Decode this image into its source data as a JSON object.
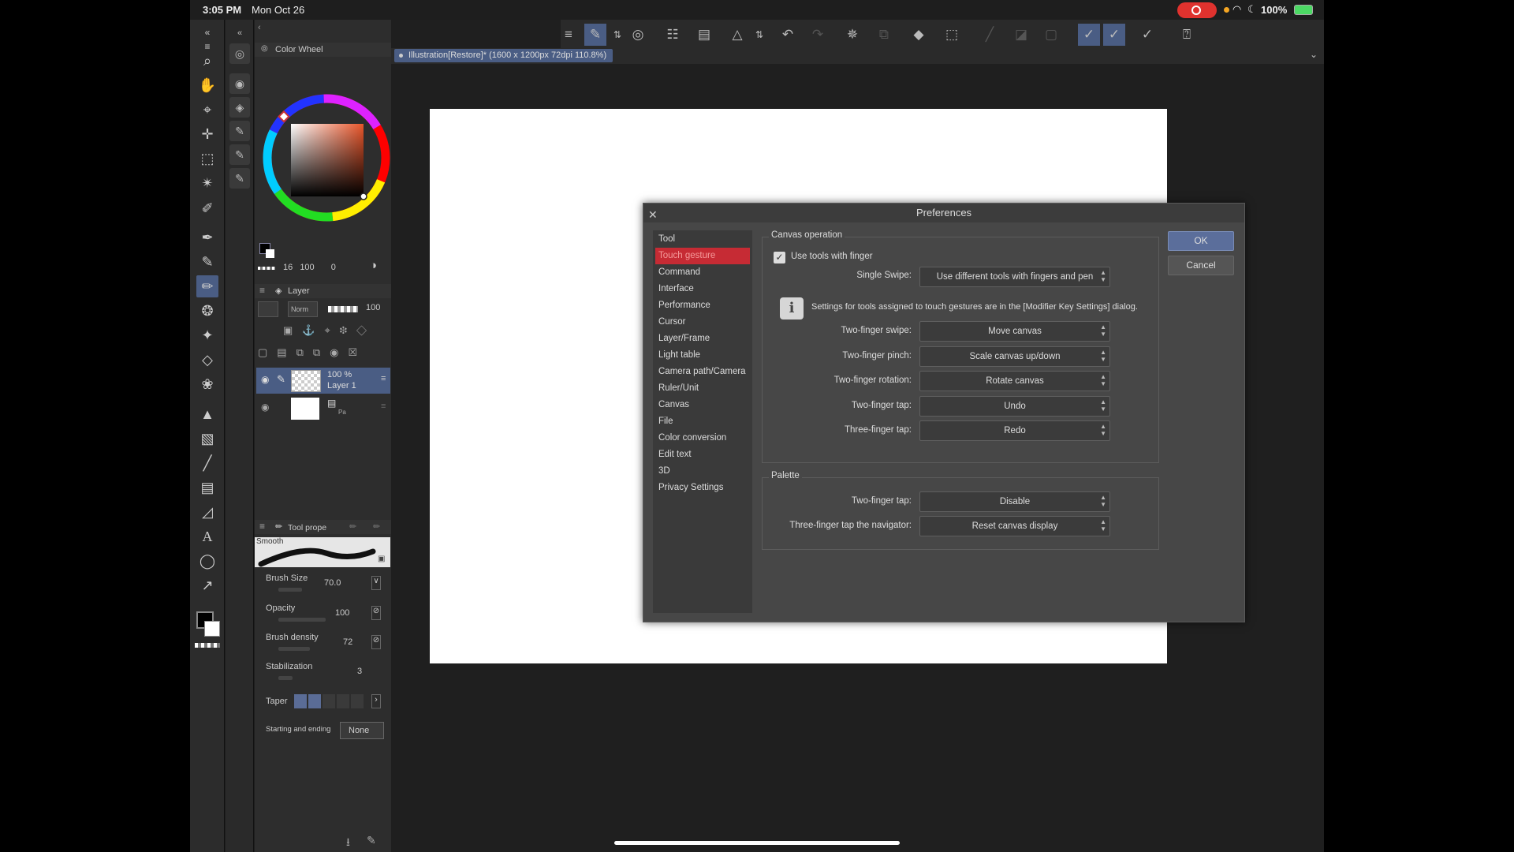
{
  "status_bar": {
    "time": "3:05 PM",
    "date": "Mon Oct 26",
    "battery": "100%"
  },
  "panels": {
    "color_wheel_title": "Color Wheel",
    "color_values": {
      "a": "16",
      "b": "100",
      "c": "0"
    },
    "layer_title": "Layer",
    "blend_mode": "Norm",
    "layer_opacity": "100",
    "layers": [
      {
        "percent": "100 %",
        "name": "Layer 1"
      },
      {
        "percent": "",
        "name": "Pa"
      }
    ],
    "tool_property_title": "Tool prope",
    "brush_name": "Smooth",
    "props": [
      {
        "label": "Brush Size",
        "value": "70.0"
      },
      {
        "label": "Opacity",
        "value": "100"
      },
      {
        "label": "Brush density",
        "value": "72"
      },
      {
        "label": "Stabilization",
        "value": "3"
      }
    ],
    "taper_label": "Taper",
    "start_end_label": "Starting and ending",
    "start_end_value": "None"
  },
  "document_tab": "Illustration[Restore]* (1600 x 1200px 72dpi 110.8%)",
  "dialog": {
    "title": "Preferences",
    "categories": [
      "Tool",
      "Touch gesture",
      "Command",
      "Interface",
      "Performance",
      "Cursor",
      "Layer/Frame",
      "Light table",
      "Camera path/Camera",
      "Ruler/Unit",
      "Canvas",
      "File",
      "Color conversion",
      "Edit text",
      "3D",
      "Privacy Settings"
    ],
    "selected_category": "Touch gesture",
    "canvas_group_label": "Canvas operation",
    "use_tools_label": "Use tools with finger",
    "single_swipe_label": "Single Swipe:",
    "single_swipe_value": "Use different tools with fingers and pen",
    "info_text": "Settings for tools assigned to touch gestures are in the [Modifier Key Settings] dialog.",
    "canvas_rows": [
      {
        "label": "Two-finger swipe:",
        "value": "Move canvas"
      },
      {
        "label": "Two-finger pinch:",
        "value": "Scale canvas up/down"
      },
      {
        "label": "Two-finger rotation:",
        "value": "Rotate canvas"
      },
      {
        "label": "Two-finger tap:",
        "value": "Undo"
      },
      {
        "label": "Three-finger tap:",
        "value": "Redo"
      }
    ],
    "palette_group_label": "Palette",
    "palette_rows": [
      {
        "label": "Two-finger tap:",
        "value": "Disable"
      },
      {
        "label": "Three-finger tap the navigator:",
        "value": "Reset canvas display"
      }
    ],
    "ok_label": "OK",
    "cancel_label": "Cancel"
  },
  "colors": {
    "accent": "#4a5d84",
    "selected_category": "#c62b34",
    "ok_button": "#5b6e9b"
  }
}
